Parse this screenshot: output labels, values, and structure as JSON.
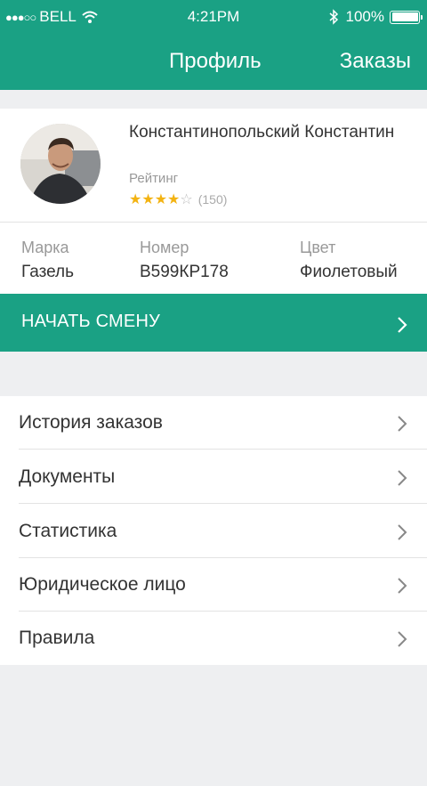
{
  "status_bar": {
    "signal": "●●●○○",
    "carrier": "BELL",
    "time": "4:21PM",
    "battery": "100%",
    "wifi_icon": "wifi-icon",
    "bluetooth_icon": "bluetooth-icon"
  },
  "nav": {
    "title": "Профиль",
    "orders_link": "Заказы"
  },
  "profile": {
    "name": "Константинопольский Константин",
    "rating_label": "Рейтинг",
    "rating": 4,
    "rating_max": 5,
    "rating_count": "(150)"
  },
  "car": {
    "brand_label": "Марка",
    "brand_value": "Газель",
    "plate_label": "Номер",
    "plate_value": "В599КР178",
    "color_label": "Цвет",
    "color_value": "Фиолетовый"
  },
  "shift_button": {
    "label": "НАЧАТЬ СМЕНУ"
  },
  "menu": {
    "items": [
      {
        "label": "История заказов"
      },
      {
        "label": "Документы"
      },
      {
        "label": "Статистика"
      },
      {
        "label": "Юридическое лицо"
      },
      {
        "label": "Правила"
      }
    ]
  },
  "colors": {
    "accent": "#1aa184",
    "star": "#f3b312",
    "background": "#eeeff1"
  }
}
